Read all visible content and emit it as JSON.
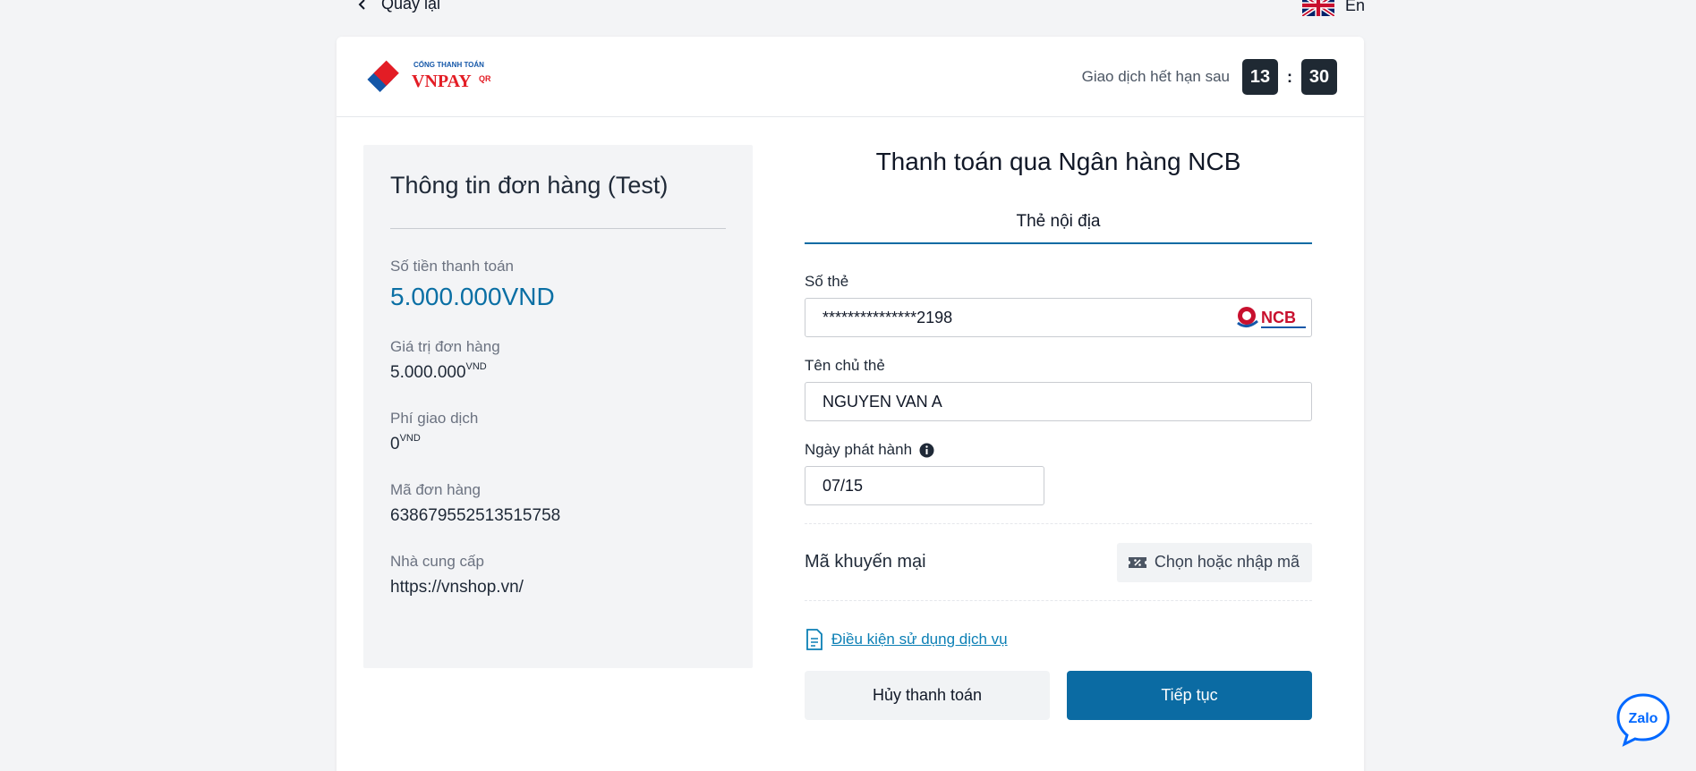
{
  "nav": {
    "back_label": "Quay lại",
    "lang_label": "En"
  },
  "header": {
    "logo_top": "CỔNG THANH TOÁN",
    "logo_main": "VNPAY",
    "logo_qr": "QR",
    "timer_label": "Giao dịch hết hạn sau",
    "minutes": "13",
    "seconds": "30",
    "colon": ":"
  },
  "order": {
    "title": "Thông tin đơn hàng (Test)",
    "amount_label": "Số tiền thanh toán",
    "amount_value": "5.000.000VND",
    "order_value_label": "Giá trị đơn hàng",
    "order_value": "5.000.000",
    "fee_label": "Phí giao dịch",
    "fee_value": "0",
    "unit": "VND",
    "order_id_label": "Mã đơn hàng",
    "order_id": "638679552513515758",
    "provider_label": "Nhà cung cấp",
    "provider": "https://vnshop.vn/"
  },
  "payment": {
    "title": "Thanh toán qua Ngân hàng NCB",
    "tab": "Thẻ nội địa",
    "card_number_label": "Số thẻ",
    "card_number": "***************2198",
    "bank_logo_text": "NCB",
    "holder_label": "Tên chủ thẻ",
    "holder": "NGUYEN VAN A",
    "issue_date_label": "Ngày phát hành",
    "issue_date": "07/15",
    "promo_label": "Mã khuyến mại",
    "promo_button": "Chọn hoặc nhập mã",
    "terms": "Điều kiện sử dụng dịch vụ",
    "cancel": "Hủy thanh toán",
    "continue": "Tiếp tục"
  },
  "zalo": {
    "label": "Zalo"
  },
  "colors": {
    "primary": "#0b6ba3",
    "accent_text": "#0a6fa4",
    "timer_bg": "#1f2933",
    "brand_red": "#e31d25",
    "brand_blue": "#1457a8"
  }
}
